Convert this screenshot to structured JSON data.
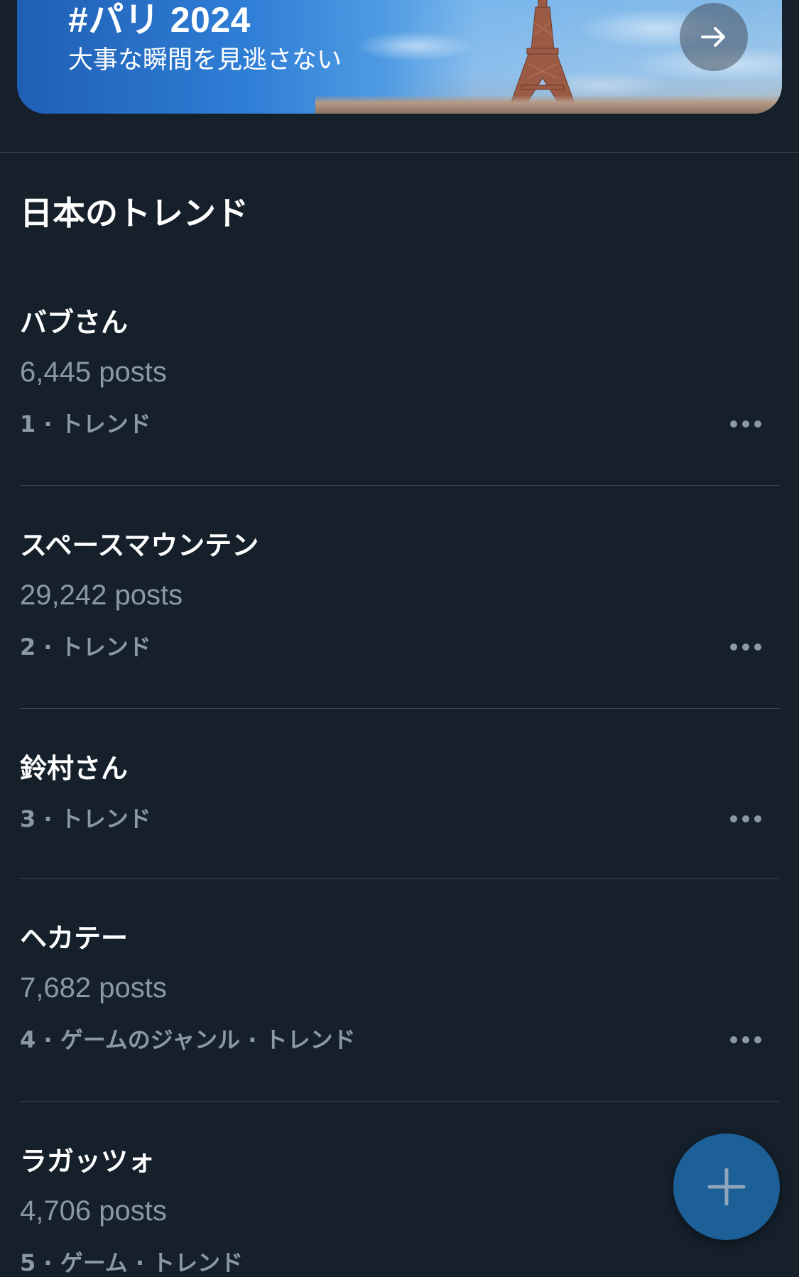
{
  "banner": {
    "title": "#パリ 2024",
    "subtitle": "大事な瞬間を見逃さない",
    "arrow_icon": "arrow-right-icon"
  },
  "trends_section": {
    "title": "日本のトレンド",
    "items": [
      {
        "name": "バブさん",
        "posts": "6,445 posts",
        "meta": "1 · トレンド"
      },
      {
        "name": "スペースマウンテン",
        "posts": "29,242 posts",
        "meta": "2 · トレンド"
      },
      {
        "name": "鈴村さん",
        "posts": "",
        "meta": "3 · トレンド"
      },
      {
        "name": "ヘカテー",
        "posts": "7,682 posts",
        "meta": "4 · ゲームのジャンル · トレンド"
      },
      {
        "name": "ラガッツォ",
        "posts": "4,706 posts",
        "meta": "5 · ゲーム · トレンド"
      }
    ]
  },
  "fab": {
    "icon": "plus-icon"
  },
  "colors": {
    "background": "#15202b",
    "secondary_text": "#8b98a5",
    "divider": "#38444d",
    "fab": "#1d5f97"
  }
}
